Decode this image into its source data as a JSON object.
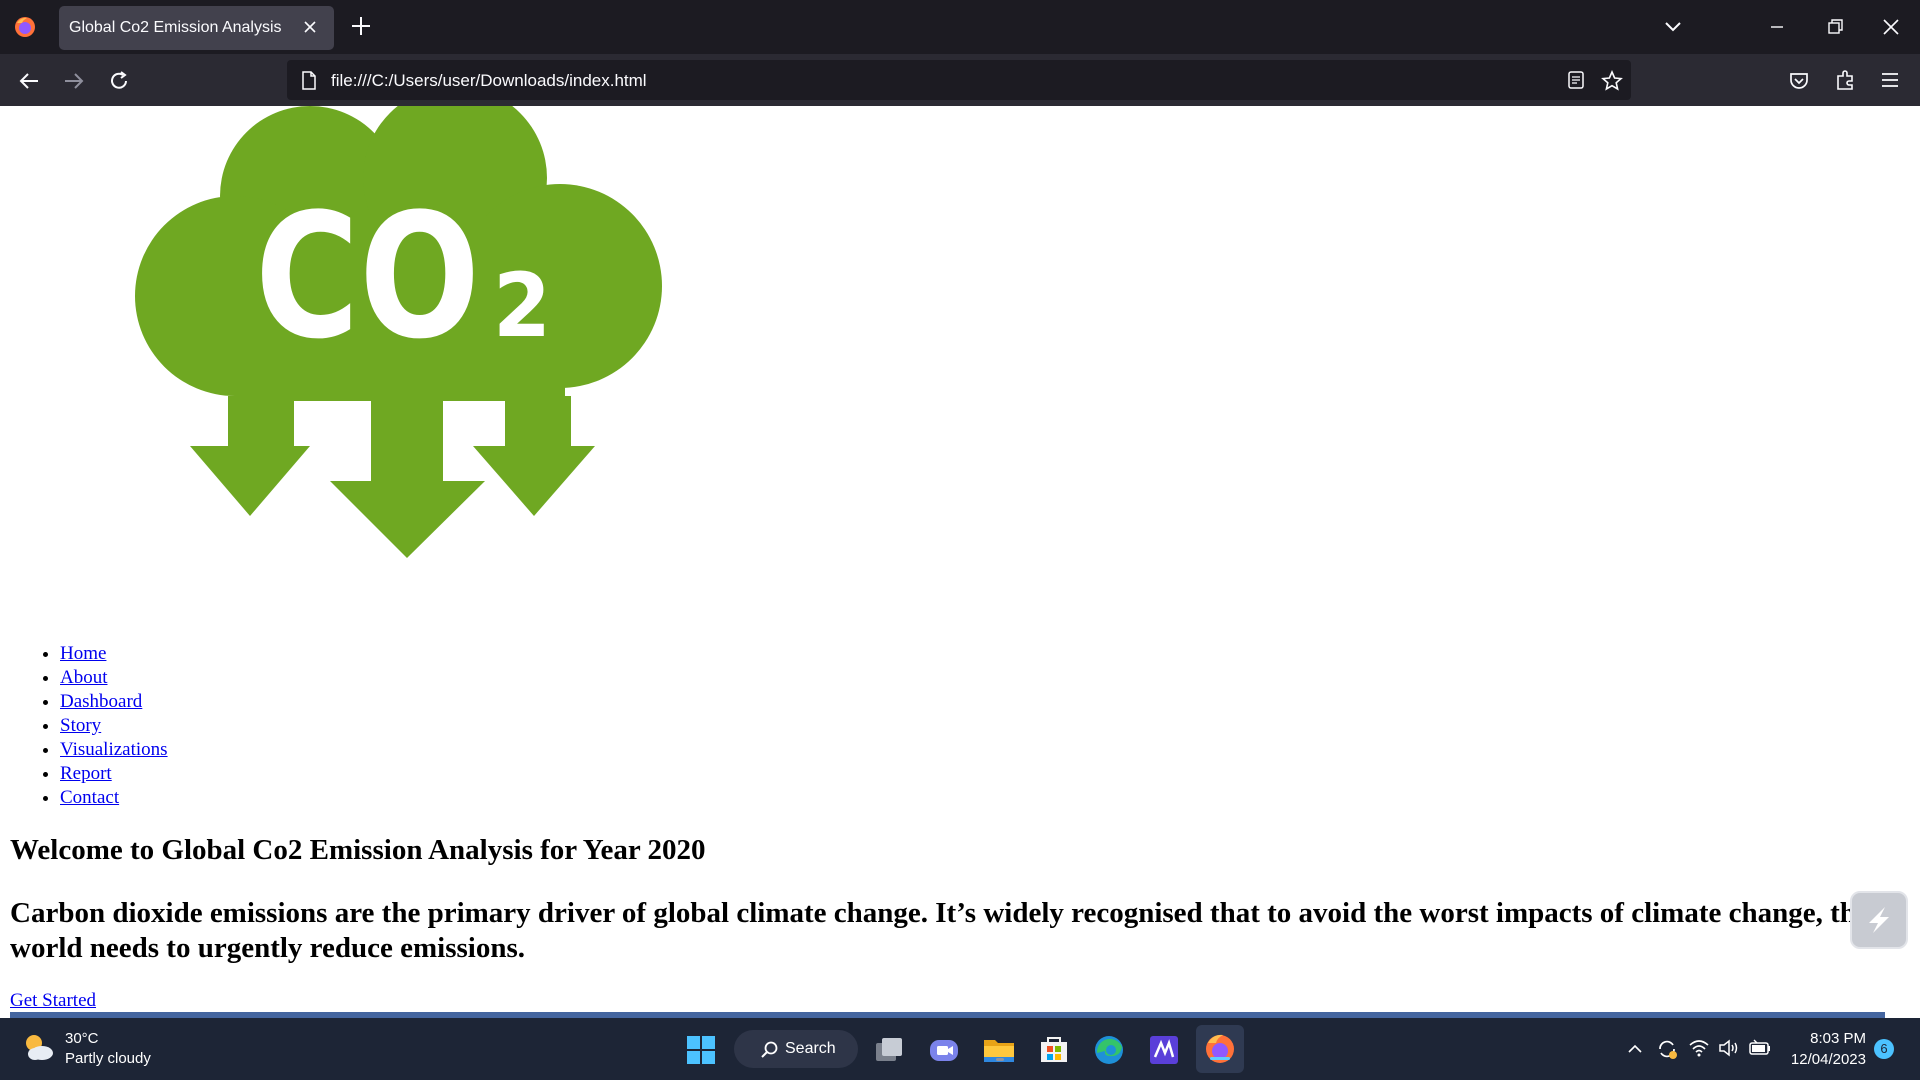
{
  "browser": {
    "tab": {
      "title": "Global Co2 Emission Analysis"
    },
    "url": "file:///C:/Users/user/Downloads/index.html"
  },
  "page": {
    "logo": {
      "main_text": "CO",
      "subscript": "2",
      "color": "#6fa822"
    },
    "nav": [
      "Home",
      "About",
      "Dashboard",
      "Story",
      "Visualizations",
      "Report",
      "Contact"
    ],
    "welcome_heading": "Welcome to Global Co2 Emission Analysis for Year 2020",
    "description": "Carbon dioxide emissions are the primary driver of global climate change. It’s widely recognised that to avoid the worst impacts of climate change, the world needs to urgently reduce emissions.",
    "cta_link": "Get Started",
    "link_color": "#0000ee"
  },
  "taskbar": {
    "weather": {
      "temp": "30°C",
      "condition": "Partly cloudy"
    },
    "search_label": "Search",
    "clock": {
      "time": "8:03 PM",
      "date": "12/04/2023"
    },
    "notification_count": "6",
    "apps": [
      "start",
      "search",
      "task-view",
      "teams-chat",
      "file-explorer",
      "microsoft-store",
      "edge",
      "visual-studio",
      "firefox"
    ]
  }
}
